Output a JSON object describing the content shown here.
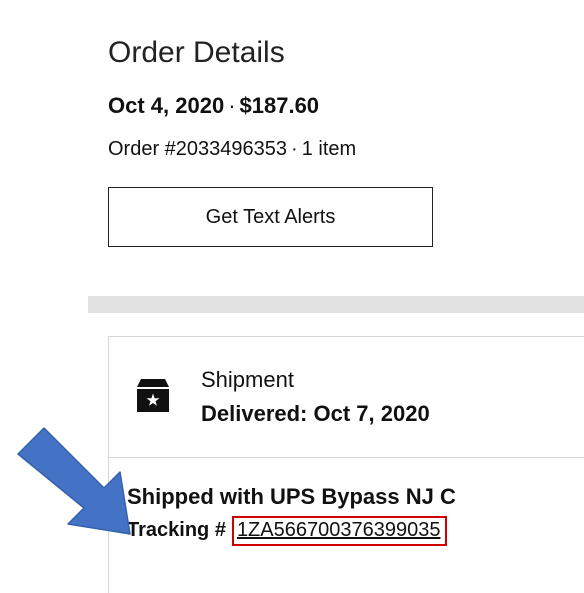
{
  "header": {
    "title": "Order Details",
    "date": "Oct 4, 2020",
    "separator": "·",
    "total": "$187.60",
    "order_number": "Order #2033496353",
    "item_count": "1 item"
  },
  "alerts_button": {
    "label": "Get Text Alerts"
  },
  "shipment": {
    "label": "Shipment",
    "status": "Delivered: Oct 7, 2020",
    "carrier": "Shipped with UPS Bypass NJ C",
    "tracking_label": "Tracking #",
    "tracking_number": "1ZA566700376399035"
  },
  "annotations": {
    "arrow_color": "#4472c4",
    "highlight_color": "#d10000"
  },
  "icons": [
    "box-star-icon",
    "pointer-arrow-icon"
  ]
}
